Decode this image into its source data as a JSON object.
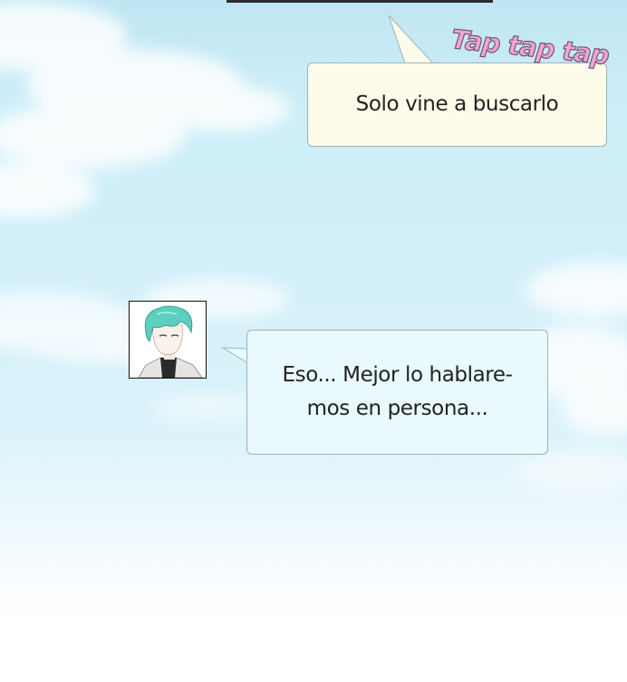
{
  "scene": {
    "sfx_text": "Tap tap tap",
    "colors": {
      "sky_top": "#bfe6f3",
      "sky_bottom": "#ffffff",
      "bubble_outgoing": "#fdfbe9",
      "bubble_incoming": "#e9f9fd",
      "bubble_border": "#9db3bb",
      "sfx_fill": "#f7a3d0",
      "avatar_hair": "#5ccfbe"
    }
  },
  "messages": [
    {
      "sender": "me",
      "text": "Solo vine a buscarlo"
    },
    {
      "sender": "contact",
      "avatar": "avatar-icon",
      "text": "Eso... Mejor lo hablare-mos en persona..."
    }
  ]
}
